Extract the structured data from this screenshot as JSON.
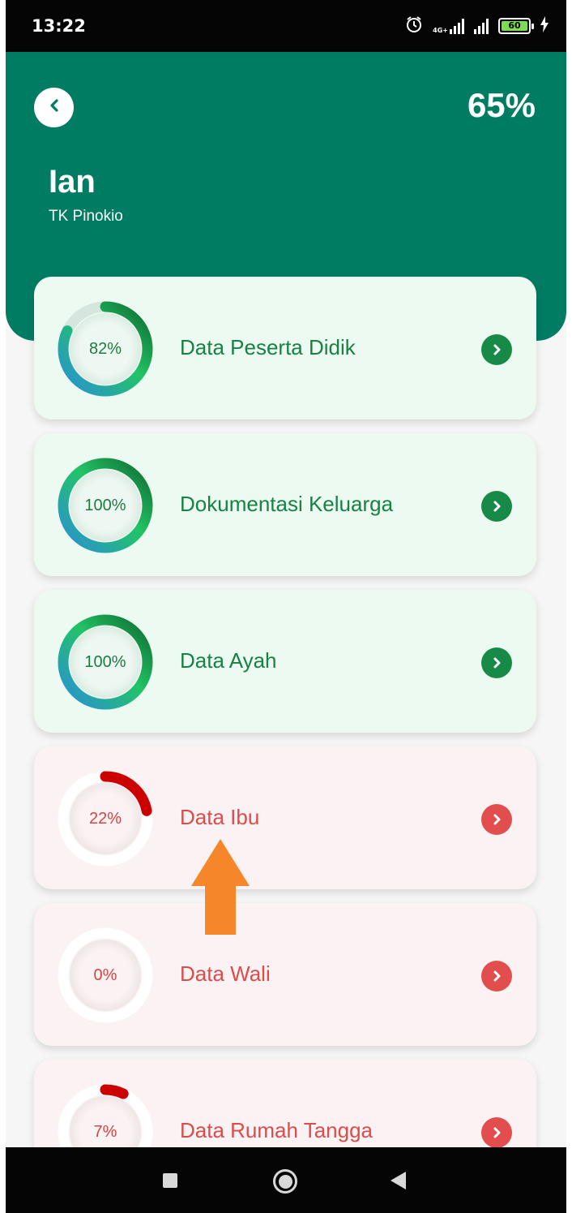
{
  "status_bar": {
    "time": "13:22",
    "network_label": "4G+",
    "battery_level": "60",
    "icons": [
      "alarm-icon",
      "signal-icon",
      "signal-icon",
      "battery-icon",
      "charging-icon"
    ]
  },
  "header": {
    "overall_progress": "65%",
    "student_name": "Ian",
    "school_name": "TK Pinokio",
    "background_color": "#007c62"
  },
  "sections": [
    {
      "title": "Data Peserta Didik",
      "percent_label": "82%",
      "progress": 0.82,
      "status": "good"
    },
    {
      "title": "Dokumentasi Keluarga",
      "percent_label": "100%",
      "progress": 1.0,
      "status": "good"
    },
    {
      "title": "Data Ayah",
      "percent_label": "100%",
      "progress": 1.0,
      "status": "good"
    },
    {
      "title": "Data Ibu",
      "percent_label": "22%",
      "progress": 0.22,
      "status": "bad"
    },
    {
      "title": "Data Wali",
      "percent_label": "0%",
      "progress": 0.0,
      "status": "bad"
    },
    {
      "title": "Data Rumah Tangga",
      "percent_label": "7%",
      "progress": 0.07,
      "status": "bad"
    }
  ],
  "colors": {
    "good_accent": "#178a48",
    "bad_accent": "#e24e4e",
    "bad_ring": "#cc0000",
    "annotation_arrow": "#f6862a"
  },
  "nav_bar": {
    "icons": [
      "recents-icon",
      "home-icon",
      "back-icon"
    ]
  }
}
